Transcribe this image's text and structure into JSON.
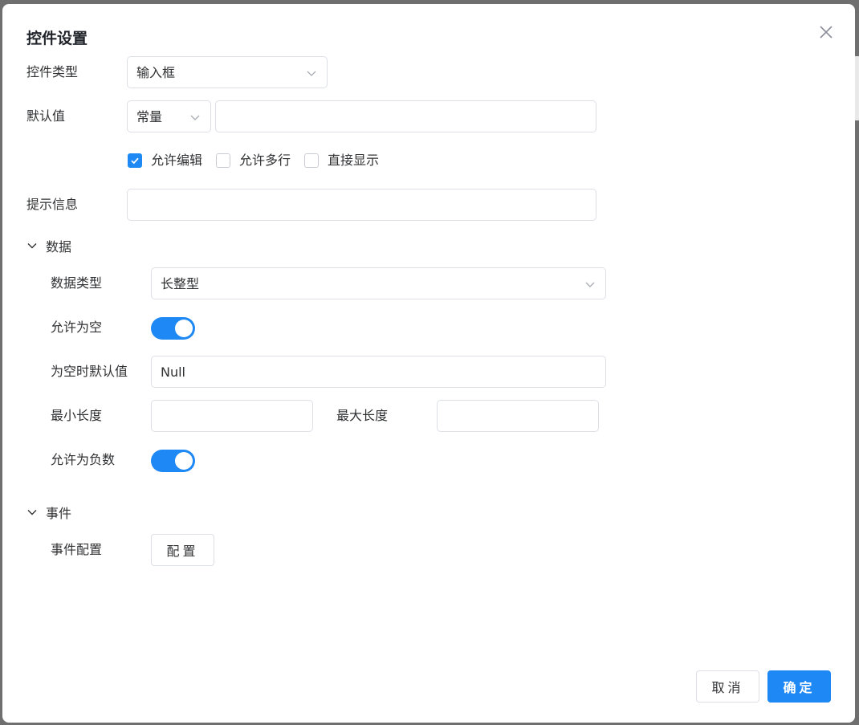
{
  "dialog": {
    "title": "控件设置"
  },
  "control_type": {
    "label": "控件类型",
    "value": "输入框"
  },
  "default_value": {
    "label": "默认值",
    "mode": "常量",
    "input_value": ""
  },
  "options": [
    {
      "label": "允许编辑",
      "checked": true
    },
    {
      "label": "允许多行",
      "checked": false
    },
    {
      "label": "直接显示",
      "checked": false
    }
  ],
  "hint": {
    "label": "提示信息",
    "value": ""
  },
  "data_section": {
    "title": "数据",
    "data_type": {
      "label": "数据类型",
      "value": "长整型"
    },
    "allow_empty": {
      "label": "允许为空",
      "on": true
    },
    "empty_default": {
      "label": "为空时默认值",
      "value": "Null"
    },
    "min_length": {
      "label": "最小长度",
      "value": ""
    },
    "max_length": {
      "label": "最大长度",
      "value": ""
    },
    "allow_negative": {
      "label": "允许为负数",
      "on": true
    }
  },
  "event_section": {
    "title": "事件",
    "config": {
      "label": "事件配置",
      "button": "配置"
    }
  },
  "footer": {
    "cancel": "取消",
    "confirm": "确定"
  },
  "colors": {
    "primary": "#1e88f5",
    "border": "#dcdfe6"
  }
}
